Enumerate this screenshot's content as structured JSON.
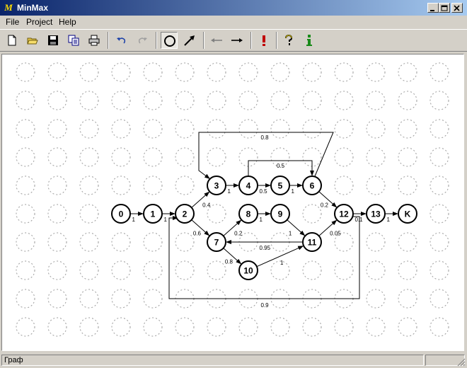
{
  "window": {
    "title": "MinMax",
    "app_icon_glyph": "M"
  },
  "menu": [
    "File",
    "Project",
    "Help"
  ],
  "toolbar": {
    "buttons": [
      {
        "name": "new-file-icon"
      },
      {
        "name": "open-folder-icon"
      },
      {
        "name": "save-icon"
      },
      {
        "name": "copy-icon"
      },
      {
        "name": "print-icon"
      },
      {
        "name": "undo-icon"
      },
      {
        "name": "redo-icon"
      },
      {
        "name": "circle-node-tool-icon"
      },
      {
        "name": "arrow-edge-tool-icon"
      },
      {
        "name": "arrow-left-icon"
      },
      {
        "name": "arrow-right-icon"
      },
      {
        "name": "exclamation-icon"
      },
      {
        "name": "help-icon"
      },
      {
        "name": "info-icon"
      }
    ],
    "pressed": "circle-node-tool-icon"
  },
  "graph": {
    "nodes": [
      {
        "id": "0",
        "col": 3,
        "row": 5
      },
      {
        "id": "1",
        "col": 4,
        "row": 5
      },
      {
        "id": "2",
        "col": 5,
        "row": 5
      },
      {
        "id": "3",
        "col": 6,
        "row": 4
      },
      {
        "id": "4",
        "col": 7,
        "row": 4
      },
      {
        "id": "5",
        "col": 8,
        "row": 4
      },
      {
        "id": "6",
        "col": 9,
        "row": 4
      },
      {
        "id": "7",
        "col": 6,
        "row": 6
      },
      {
        "id": "8",
        "col": 7,
        "row": 5
      },
      {
        "id": "9",
        "col": 8,
        "row": 5
      },
      {
        "id": "10",
        "col": 7,
        "row": 7
      },
      {
        "id": "11",
        "col": 9,
        "row": 6
      },
      {
        "id": "12",
        "col": 10,
        "row": 5
      },
      {
        "id": "13",
        "col": 11,
        "row": 5
      },
      {
        "id": "K",
        "col": 12,
        "row": 5
      }
    ],
    "edges": [
      {
        "from": "0",
        "to": "1",
        "label": "1"
      },
      {
        "from": "1",
        "to": "2",
        "label": "1"
      },
      {
        "from": "2",
        "to": "3",
        "label": "0.4"
      },
      {
        "from": "2",
        "to": "7",
        "label": "0.6"
      },
      {
        "from": "3",
        "to": "4",
        "label": "1"
      },
      {
        "from": "4",
        "to": "5",
        "label": "0.5"
      },
      {
        "from": "5",
        "to": "6",
        "label": "1"
      },
      {
        "from": "4",
        "to": "6",
        "label": "0.5",
        "route": "over"
      },
      {
        "from": "6",
        "to": "3",
        "label": "0.8",
        "route": "top"
      },
      {
        "from": "6",
        "to": "12",
        "label": "0.2"
      },
      {
        "from": "7",
        "to": "8",
        "label": "0.2"
      },
      {
        "from": "8",
        "to": "9",
        "label": "1"
      },
      {
        "from": "9",
        "to": "11",
        "label": "1"
      },
      {
        "from": "7",
        "to": "10",
        "label": "0.8"
      },
      {
        "from": "10",
        "to": "11",
        "label": "1"
      },
      {
        "from": "11",
        "to": "7",
        "label": "0.95"
      },
      {
        "from": "11",
        "to": "12",
        "label": "0.05"
      },
      {
        "from": "12",
        "to": "13",
        "label": "0.1"
      },
      {
        "from": "13",
        "to": "K",
        "label": "1"
      },
      {
        "from": "12",
        "to": "2",
        "label": "0.9",
        "route": "bottom"
      }
    ]
  },
  "status": {
    "text": "Граф"
  }
}
